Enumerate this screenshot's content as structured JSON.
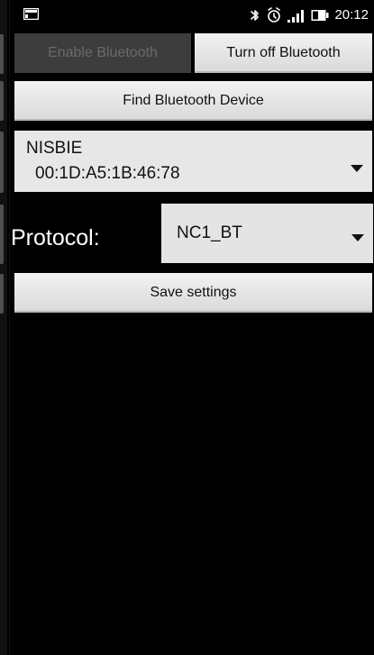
{
  "status_bar": {
    "time": "20:12",
    "icons": [
      "notification-image-icon",
      "bluetooth-icon",
      "alarm-icon",
      "signal-icon",
      "battery-icon"
    ]
  },
  "buttons": {
    "enable_bluetooth": "Enable Bluetooth",
    "turn_off_bluetooth": "Turn off Bluetooth",
    "find_device": "Find Bluetooth Device",
    "save_settings": "Save settings"
  },
  "device_select": {
    "name": "NISBIE",
    "address": "00:1D:A5:1B:46:78"
  },
  "protocol": {
    "label": "Protocol:",
    "selected": "NC1_BT"
  },
  "colors": {
    "background": "#000000",
    "button": "#e0e0e0",
    "disabled_button": "#3d3d3d",
    "text": "#111111",
    "label_text": "#ffffff"
  }
}
